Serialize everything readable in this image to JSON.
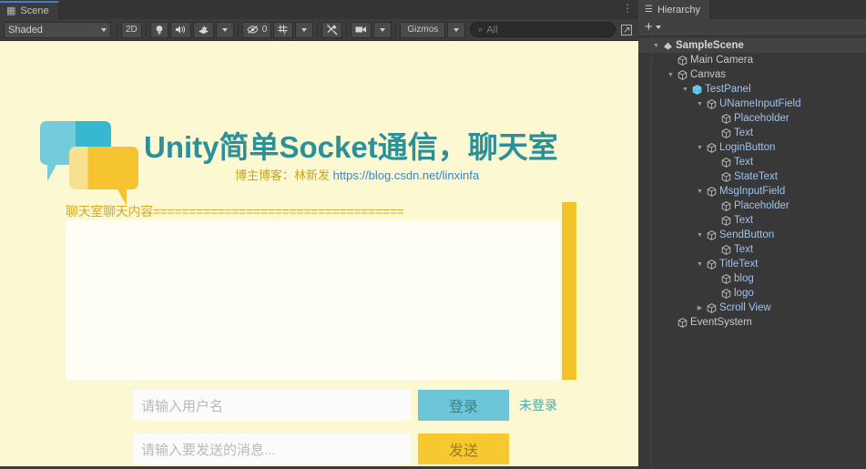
{
  "scene_panel": {
    "tab": {
      "label": "Scene",
      "icon": "grid-icon"
    },
    "menu_icon": "⋮",
    "toolbar": {
      "shading_mode": "Shaded",
      "mode_2d": "2D",
      "lighting_icon": "lightbulb-icon",
      "audio_icon": "speaker-icon",
      "fx_icon": "effects-icon",
      "hidden_count": "0",
      "hidden_icon": "eye-off-icon",
      "grid_icon": "grid-visibility-icon",
      "tools_icon": "scene-tools-icon",
      "camera_icon": "scene-camera-icon",
      "gizmos_label": "Gizmos",
      "search_placeholder": "All",
      "search_value": "",
      "search_icon": "search-icon",
      "expand_icon": "maximize-icon"
    },
    "canvas": {
      "title": "Unity简单Socket通信，聊天室",
      "blog_prefix": "博主博客：林新发",
      "blog_url": "https://blog.csdn.net/linxinfa",
      "chat_header": "聊天室聊天内容===================================",
      "username_placeholder": "请输入用户名",
      "login_button": "登录",
      "state_text": "未登录",
      "message_placeholder": "请输入要发送的消息...",
      "send_button": "发送",
      "colors": {
        "background": "#fcf8d1",
        "panel": "#fffef4",
        "title": "#2c9099",
        "accent_blue": "#6cc5d8",
        "accent_yellow": "#f6c931",
        "blog_cn": "#c9a21e",
        "blog_url": "#3a86c8",
        "chat_header": "#d4a82a",
        "state": "#4fa8aa"
      }
    }
  },
  "hierarchy_panel": {
    "tab": {
      "label": "Hierarchy",
      "icon": "list-icon"
    },
    "toolbar": {
      "add_label": "+",
      "add_icon": "plus-icon",
      "dropdown_icon": "chevron-down-icon"
    },
    "tree": [
      {
        "label": "SampleScene",
        "depth": 0,
        "arrow": "down",
        "icon": "scene-icon",
        "type": "scene"
      },
      {
        "label": "Main Camera",
        "depth": 1,
        "arrow": "none",
        "icon": "gameobject-icon",
        "type": "plain"
      },
      {
        "label": "Canvas",
        "depth": 1,
        "arrow": "down",
        "icon": "gameobject-icon",
        "type": "plain"
      },
      {
        "label": "TestPanel",
        "depth": 2,
        "arrow": "down",
        "icon": "prefab-icon",
        "type": "prefab"
      },
      {
        "label": "UNameInputField",
        "depth": 3,
        "arrow": "down",
        "icon": "gameobject-icon",
        "type": "child"
      },
      {
        "label": "Placeholder",
        "depth": 4,
        "arrow": "none",
        "icon": "gameobject-icon",
        "type": "child"
      },
      {
        "label": "Text",
        "depth": 4,
        "arrow": "none",
        "icon": "gameobject-icon",
        "type": "child"
      },
      {
        "label": "LoginButton",
        "depth": 3,
        "arrow": "down",
        "icon": "gameobject-icon",
        "type": "child"
      },
      {
        "label": "Text",
        "depth": 4,
        "arrow": "none",
        "icon": "gameobject-icon",
        "type": "child"
      },
      {
        "label": "StateText",
        "depth": 4,
        "arrow": "none",
        "icon": "gameobject-icon",
        "type": "child"
      },
      {
        "label": "MsgInputField",
        "depth": 3,
        "arrow": "down",
        "icon": "gameobject-icon",
        "type": "child"
      },
      {
        "label": "Placeholder",
        "depth": 4,
        "arrow": "none",
        "icon": "gameobject-icon",
        "type": "child"
      },
      {
        "label": "Text",
        "depth": 4,
        "arrow": "none",
        "icon": "gameobject-icon",
        "type": "child"
      },
      {
        "label": "SendButton",
        "depth": 3,
        "arrow": "down",
        "icon": "gameobject-icon",
        "type": "child"
      },
      {
        "label": "Text",
        "depth": 4,
        "arrow": "none",
        "icon": "gameobject-icon",
        "type": "child"
      },
      {
        "label": "TitleText",
        "depth": 3,
        "arrow": "down",
        "icon": "gameobject-icon",
        "type": "child"
      },
      {
        "label": "blog",
        "depth": 4,
        "arrow": "none",
        "icon": "gameobject-icon",
        "type": "child"
      },
      {
        "label": "logo",
        "depth": 4,
        "arrow": "none",
        "icon": "gameobject-icon",
        "type": "child"
      },
      {
        "label": "Scroll View",
        "depth": 3,
        "arrow": "right",
        "icon": "gameobject-icon",
        "type": "child"
      },
      {
        "label": "EventSystem",
        "depth": 1,
        "arrow": "none",
        "icon": "gameobject-icon",
        "type": "plain"
      }
    ]
  }
}
